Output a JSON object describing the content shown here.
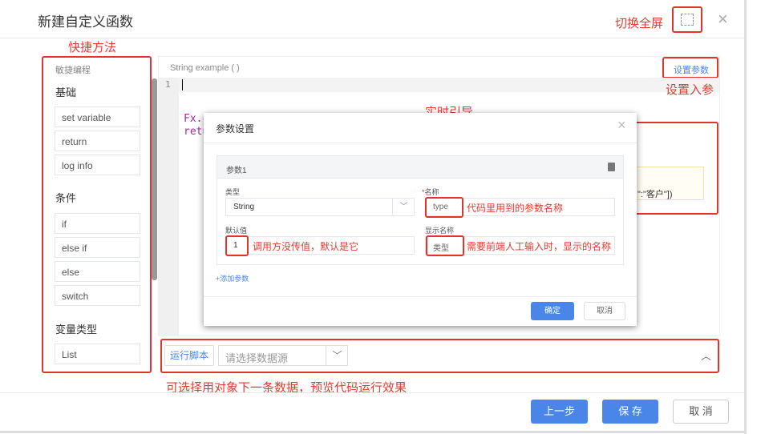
{
  "dialog": {
    "title": "新建自定义函数"
  },
  "annotations": {
    "fullscreen": "切换全屏",
    "shortcuts": "快捷方法",
    "set_params": "设置入参",
    "realtime_guide": "实时引导",
    "param_name": "代码里用到的参数名称",
    "default_value": "调用方没传值，默认是它",
    "display_name": "需要前端人工输入时，显示的名称",
    "run_preview": "可选择用对象下一条数据，预览代码运行效果"
  },
  "sidebar": {
    "header": "敏捷编程",
    "sections": [
      {
        "title": "基础",
        "items": [
          "set variable",
          "return",
          "log info"
        ]
      },
      {
        "title": "条件",
        "items": [
          "if",
          "else if",
          "else",
          "switch"
        ]
      },
      {
        "title": "变量类型",
        "items": [
          "List"
        ]
      }
    ]
  },
  "editor": {
    "signature": "String example ( )",
    "set_params_button": "设置参数",
    "line_numbers": [
      "1"
    ],
    "code_lines": [
      "Fx.c",
      "retu"
    ],
    "hint_code": "\":\"客户\"])"
  },
  "modal": {
    "title": "参数设置",
    "param": {
      "title": "参数1",
      "type_label": "类型",
      "type_value": "String",
      "name_label": "名称",
      "name_value": "type",
      "default_label": "默认值",
      "default_value": "1",
      "display_label": "显示名称",
      "display_value": "类型"
    },
    "add_param": "+添加参数",
    "ok": "确定",
    "cancel": "取消"
  },
  "runbar": {
    "run_button": "运行脚本",
    "datasource_placeholder": "请选择数据源"
  },
  "footer": {
    "prev": "上一步",
    "save": "保 存",
    "cancel": "取 消"
  },
  "colors": {
    "accent": "#4a86e8",
    "annotation": "#e0352b"
  }
}
